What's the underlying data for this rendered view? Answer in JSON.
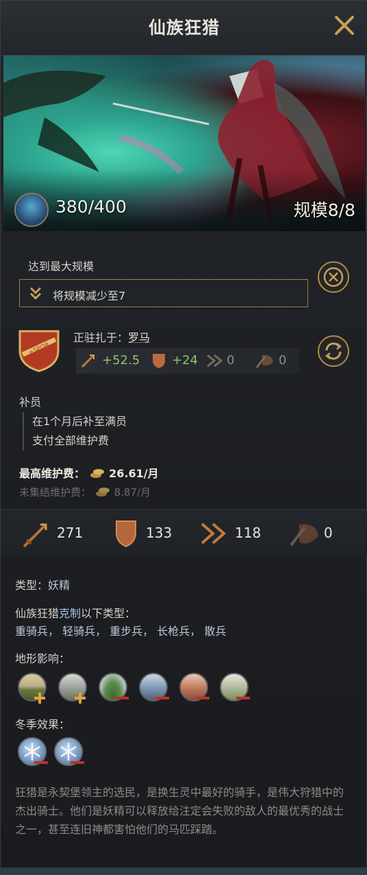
{
  "header": {
    "title": "仙族狂猎"
  },
  "banner": {
    "hp": "380/400",
    "scale": "规模8/8"
  },
  "max_scale": {
    "label": "达到最大规模",
    "reduce_button": "将规模减少至7"
  },
  "garrison": {
    "prefix": "正驻扎于：",
    "location": "罗马",
    "attack_bonus": "+52.5",
    "defense_bonus": "+24",
    "pursuit_bonus": "0",
    "screen_bonus": "0"
  },
  "recruit": {
    "title": "补员",
    "lines": [
      "在1个月后补至满员",
      "支付全部维护费"
    ]
  },
  "upkeep": {
    "max_label": "最高维护费：",
    "max_value": "26.61/月",
    "unmustered_label": "未集结维护费：",
    "unmustered_value": "8.87/月"
  },
  "stats": {
    "attack": "271",
    "defense": "133",
    "pursuit": "118",
    "screen": "0"
  },
  "info": {
    "type_label": "类型：",
    "type_value": "妖精",
    "counter_prefix": "仙族狂猎",
    "counter_keyword": "克制",
    "counter_suffix": "以下类型：",
    "counter_list": "重骑兵， 轻骑兵， 重步兵， 长枪兵， 散兵",
    "terrain_title": "地形影响：",
    "winter_title": "冬季效果："
  },
  "terrain_icons": [
    {
      "name": "plains-terrain-icon",
      "effect": "plus"
    },
    {
      "name": "forest-terrain-icon",
      "effect": "plus"
    },
    {
      "name": "hills-terrain-icon",
      "effect": "minus"
    },
    {
      "name": "mountains-terrain-icon",
      "effect": "minus"
    },
    {
      "name": "desert-mountains-terrain-icon",
      "effect": "minus"
    },
    {
      "name": "wetlands-terrain-icon",
      "effect": "minus"
    }
  ],
  "description": "狂猎是永契堡领主的选民，是换生灵中最好的骑手，是伟大狩猎中的杰出骑士。他们是妖精可以释放给注定会失败的敌人的最优秀的战士之一，甚至连旧神都害怕他们的马匹踩踏。",
  "colors": {
    "gold": "#b48a3e",
    "green": "#8fc26a",
    "red_minus": "#b8322c",
    "plus": "#e0a43c"
  }
}
